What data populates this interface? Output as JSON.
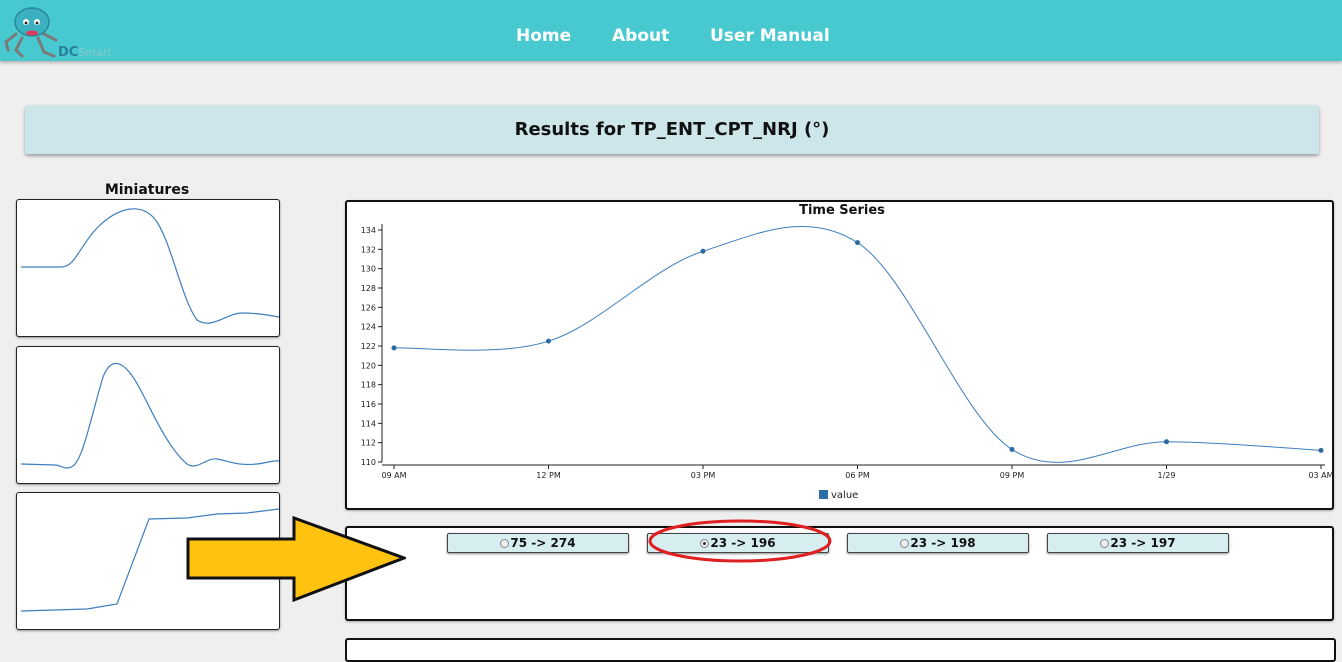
{
  "nav": {
    "logo_text": "DC",
    "logo_sub": "Smart",
    "home": "Home",
    "about": "About",
    "manual": "User Manual"
  },
  "banner": {
    "title": "Results for TP_ENT_CPT_NRJ (°)"
  },
  "miniatures": {
    "title": "Miniatures"
  },
  "chart_data": {
    "type": "line",
    "title": "Time Series",
    "x": [
      "09 AM",
      "12 PM",
      "03 PM",
      "06 PM",
      "09 PM",
      "1/29",
      "03 AM"
    ],
    "series": [
      {
        "name": "value",
        "values": [
          121.8,
          122.5,
          131.8,
          132.7,
          111.3,
          112.1,
          111.2
        ]
      }
    ],
    "ylim": [
      110,
      134
    ],
    "yticks": [
      110,
      112,
      114,
      116,
      118,
      120,
      122,
      124,
      126,
      128,
      130,
      132,
      134
    ],
    "line_color": "#3d7ebd",
    "legend_position": "bottom-center"
  },
  "segments": [
    {
      "label": "75 -> 274",
      "selected": false
    },
    {
      "label": "23 -> 196",
      "selected": true
    },
    {
      "label": "23 -> 198",
      "selected": false
    },
    {
      "label": "23 -> 197",
      "selected": false
    }
  ],
  "colors": {
    "header": "#48c9d0",
    "banner": "#cde6ea",
    "button": "#d7eef0",
    "highlight": "#e02020",
    "arrow": "#ffc20e"
  }
}
